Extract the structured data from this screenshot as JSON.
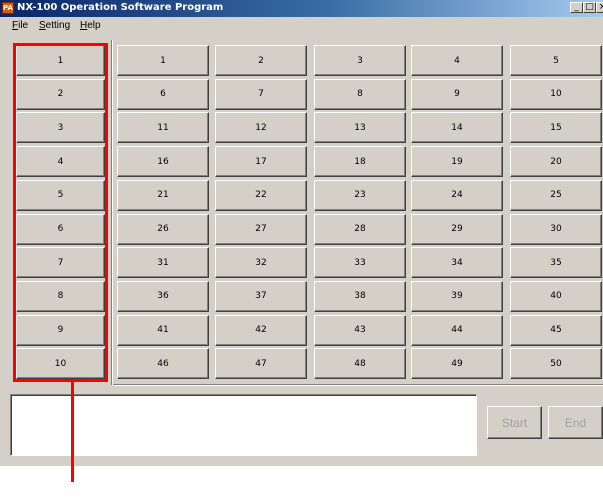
{
  "window": {
    "title": "NX-100 Operation Software Program",
    "icon_label": "PA",
    "controls": [
      "_",
      "□",
      "×"
    ]
  },
  "menu": [
    {
      "label": "File"
    },
    {
      "label": "Setting"
    },
    {
      "label": "Help"
    }
  ],
  "groups": [
    "1",
    "2",
    "3",
    "4",
    "5",
    "6",
    "7",
    "8",
    "9",
    "10"
  ],
  "channels": [
    [
      "1",
      "2",
      "3",
      "4",
      "5"
    ],
    [
      "6",
      "7",
      "8",
      "9",
      "10"
    ],
    [
      "11",
      "12",
      "13",
      "14",
      "15"
    ],
    [
      "16",
      "17",
      "18",
      "19",
      "20"
    ],
    [
      "21",
      "22",
      "23",
      "24",
      "25"
    ],
    [
      "26",
      "27",
      "28",
      "29",
      "30"
    ],
    [
      "31",
      "32",
      "33",
      "34",
      "35"
    ],
    [
      "36",
      "37",
      "38",
      "39",
      "40"
    ],
    [
      "41",
      "42",
      "43",
      "44",
      "45"
    ],
    [
      "46",
      "47",
      "48",
      "49",
      "50"
    ]
  ],
  "status_text": "",
  "actions": {
    "start_label": "Start",
    "end_label": "End",
    "start_enabled": false,
    "end_enabled": false
  },
  "annotation": {
    "highlight_color": "#ff0000"
  }
}
